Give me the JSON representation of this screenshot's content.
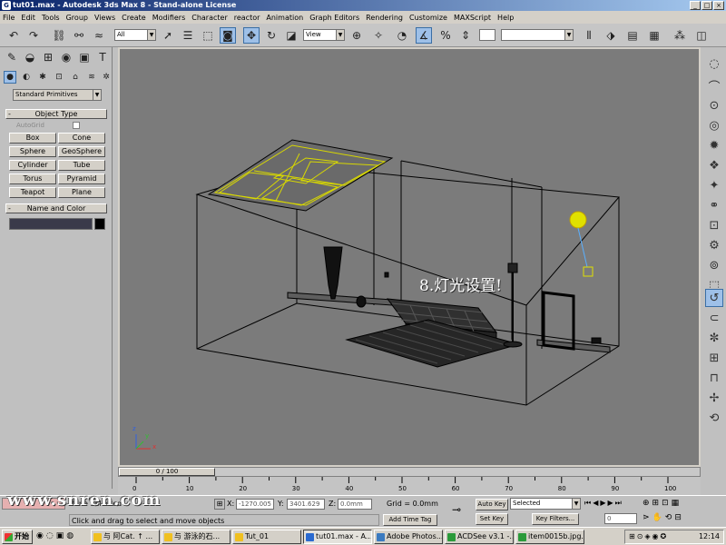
{
  "window": {
    "title": "tut01.max - Autodesk 3ds Max 8 - Stand-alone License",
    "minimize": "_",
    "maximize": "□",
    "close": "×"
  },
  "menu": [
    "File",
    "Edit",
    "Tools",
    "Group",
    "Views",
    "Create",
    "Modifiers",
    "Character",
    "reactor",
    "Animation",
    "Graph Editors",
    "Rendering",
    "Customize",
    "MAXScript",
    "Help"
  ],
  "toolbar": {
    "selection_filter": "All",
    "ref_coord": "View",
    "named_selection": ""
  },
  "command_panel": {
    "category": "Standard Primitives",
    "object_type_header": "Object Type",
    "autogrid_label": "AutoGrid",
    "primitives": [
      "Box",
      "Cone",
      "Sphere",
      "GeoSphere",
      "Cylinder",
      "Tube",
      "Torus",
      "Pyramid",
      "Teapot",
      "Plane"
    ],
    "name_color_header": "Name and Color",
    "object_name": ""
  },
  "viewport": {
    "overlay_text": "8.灯光设置!",
    "axis_x": "x",
    "axis_y": "y",
    "axis_z": "z"
  },
  "time_slider": {
    "frame_label": "0 / 100"
  },
  "trackbar": {
    "ticks": [
      "0",
      "10",
      "20",
      "30",
      "40",
      "50",
      "60",
      "70",
      "80",
      "90",
      "100"
    ]
  },
  "status": {
    "selection_info": "None Selected",
    "prompt": "Click and drag to select and move objects",
    "x_label": "X:",
    "x_value": "-1270.005",
    "y_label": "Y:",
    "y_value": "3401.629",
    "z_label": "Z:",
    "z_value": "0.0mm",
    "grid": "Grid = 0.0mm",
    "add_time_tag": "Add Time Tag",
    "auto_key": "Auto Key",
    "set_key": "Set Key",
    "key_mode": "Selected",
    "key_filters": "Key Filters...",
    "frame_value": "0"
  },
  "taskbar": {
    "start": "开始",
    "tasks": [
      "与 阿Cat. ↑ ...",
      "与 游泳的石...",
      "Tut_01",
      "tut01.max - A...",
      "Adobe Photos...",
      "ACDSee v3.1 -...",
      "item0015b.jpg..."
    ],
    "clock": "12:14"
  },
  "watermark": "www.snren.com"
}
